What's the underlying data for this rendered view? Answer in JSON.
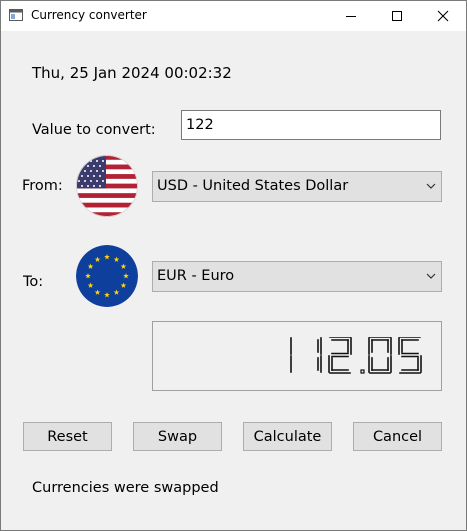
{
  "window": {
    "title": "Currency converter",
    "controls": [
      "minimize",
      "maximize",
      "close"
    ]
  },
  "datetime": "Thu, 25 Jan 2024 00:02:32",
  "value_to_convert": {
    "label": "Value to convert:",
    "value": "122"
  },
  "from": {
    "label": "From:",
    "selected": "USD - United States Dollar",
    "flag_icon": "us-flag-icon"
  },
  "to": {
    "label": "To:",
    "selected": "EUR - Euro",
    "flag_icon": "eu-flag-icon"
  },
  "result": {
    "display": "112.05"
  },
  "buttons": {
    "reset": "Reset",
    "swap": "Swap",
    "calculate": "Calculate",
    "cancel": "Cancel"
  },
  "status": "Currencies were swapped",
  "colors": {
    "us_red": "#b22234",
    "us_blue": "#3c3b6e",
    "eu_blue": "#0f3f9c",
    "eu_star": "#ffd500",
    "window_bg": "#f0f0f0"
  }
}
